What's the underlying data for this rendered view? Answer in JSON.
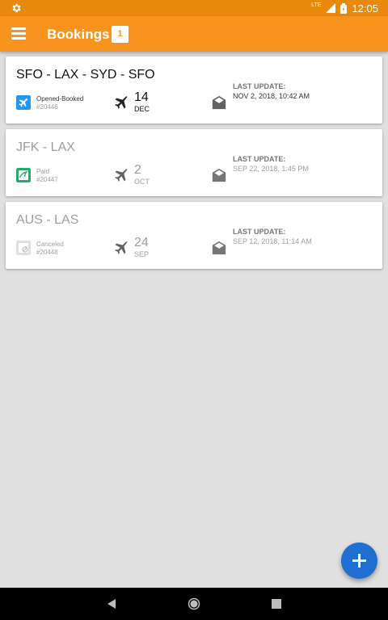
{
  "status_bar": {
    "time": "12:05",
    "network": "LTE"
  },
  "app_bar": {
    "title": "Bookings",
    "badge_count": "1",
    "accent": "#f7941d"
  },
  "bookings": [
    {
      "route": "SFO - LAX - SYD - SFO",
      "status": "Opened-Booked",
      "number": "#20446",
      "day": "14",
      "month": "DEC",
      "update_label": "LAST UPDATE:",
      "update_value": "NOV 2, 2018, 10:42 AM",
      "status_color": "#2196f3"
    },
    {
      "route": "JFK - LAX",
      "status": "Paid",
      "number": "#20447",
      "day": "2",
      "month": "OCT",
      "update_label": "LAST UPDATE:",
      "update_value": "SEP 22, 2018, 1:45 PM",
      "status_color": "#26a96c"
    },
    {
      "route": "AUS - LAS",
      "status": "Canceled",
      "number": "#20448",
      "day": "24",
      "month": "SEP",
      "update_label": "LAST UPDATE:",
      "update_value": "SEP 12, 2018, 11:14 AM",
      "status_color": "#cfcfcf"
    }
  ],
  "fab": {
    "icon": "plus-icon",
    "color": "#1e6fd0"
  }
}
